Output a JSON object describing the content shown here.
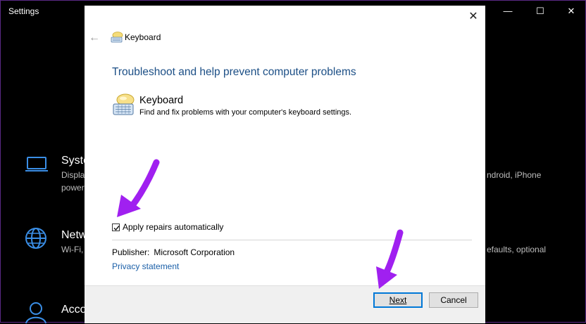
{
  "settings_window": {
    "title": "Settings",
    "minimize_glyph": "—",
    "maximize_glyph": "☐",
    "close_glyph": "✕",
    "tiles": [
      {
        "icon": "laptop-icon",
        "title": "Syste",
        "desc": [
          "Displa",
          "power"
        ]
      },
      {
        "icon": "globe-icon",
        "title": "Netw",
        "desc": [
          "Wi-Fi,"
        ]
      },
      {
        "icon": "person-icon",
        "title": "Acco",
        "desc": []
      }
    ],
    "right_descs": [
      "ndroid, iPhone",
      "efaults, optional"
    ]
  },
  "dialog": {
    "close_glyph": "✕",
    "back_glyph": "←",
    "header_icon": "keyboard-icon",
    "header_title": "Keyboard",
    "main_title": "Troubleshoot and help prevent computer problems",
    "item_icon": "keyboard-troubleshooter-icon",
    "item_title": "Keyboard",
    "item_desc": "Find and fix problems with your computer's keyboard settings.",
    "checkbox": {
      "label": "Apply repairs automatically",
      "checked": true
    },
    "publisher_label": "Publisher:",
    "publisher_value": "Microsoft Corporation",
    "privacy_link": "Privacy statement",
    "buttons": {
      "next": "Next",
      "cancel": "Cancel"
    }
  },
  "colors": {
    "accent": "#0078d7",
    "title_blue": "#1c4f86",
    "link_blue": "#1a5fa8",
    "annotation_arrow": "#a020f0"
  }
}
